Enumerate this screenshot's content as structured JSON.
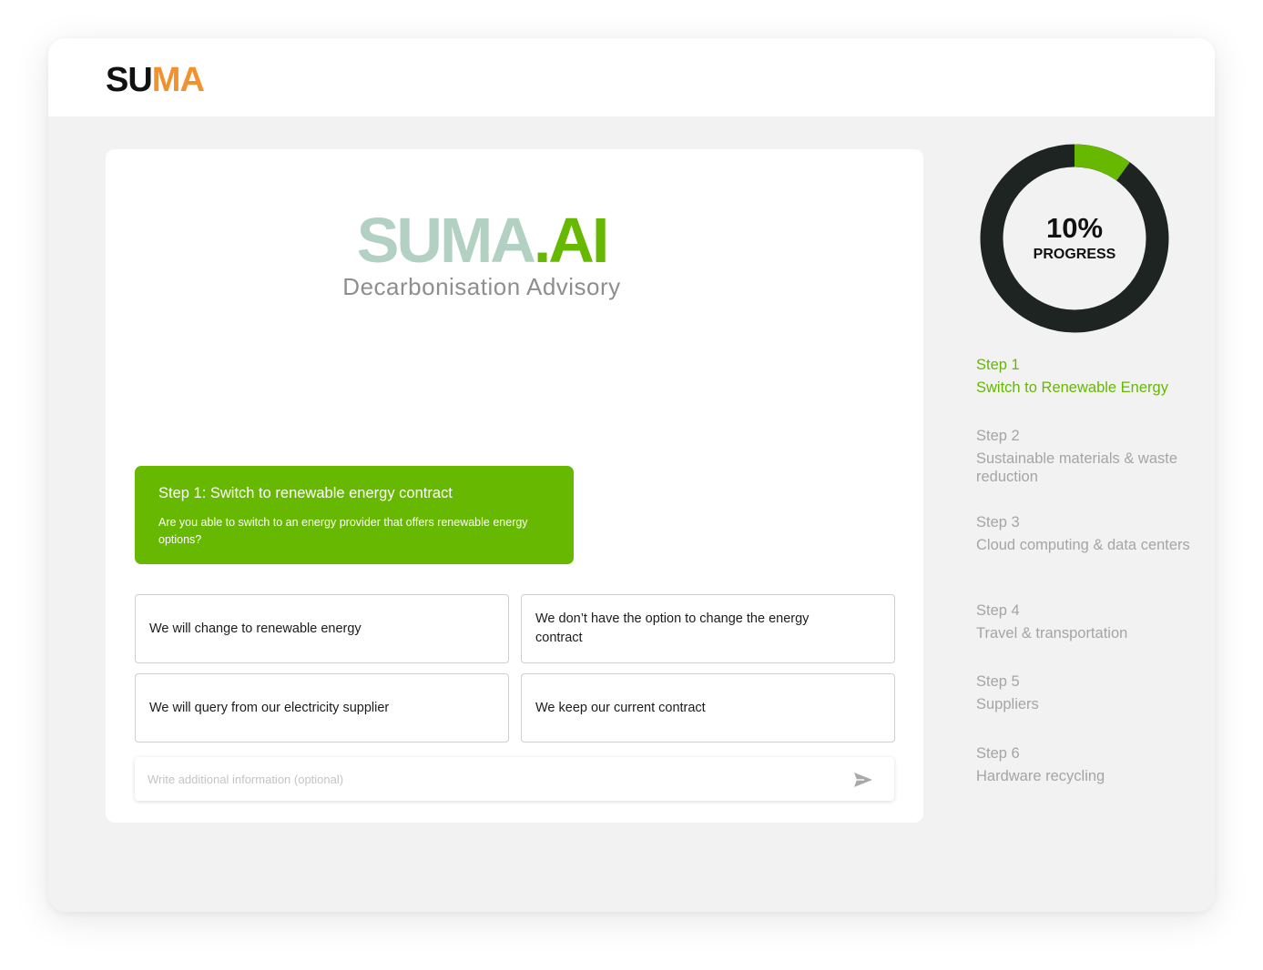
{
  "app": {
    "brand_part1": "SU",
    "brand_part2": "MA",
    "accent_color": "#66b800",
    "brand_orange": "#f0922e"
  },
  "hero": {
    "logo_part1": "SUMA",
    "logo_part2": ".AI",
    "subtitle": "Decarbonisation Advisory"
  },
  "question": {
    "title": "Step 1: Switch to renewable energy contract",
    "text": "Are you able to switch to an energy provider that offers renewable energy options?"
  },
  "options": [
    {
      "label": "We will change to renewable energy"
    },
    {
      "label": "We don’t have the option to change the energy contract"
    },
    {
      "label": "We will query from our electricity supplier"
    },
    {
      "label": "We keep our current contract"
    }
  ],
  "input": {
    "placeholder": "Write additional information (optional)",
    "send_icon": "send-icon"
  },
  "progress": {
    "value_text": "10%",
    "label": "PROGRESS",
    "fraction": 0.1,
    "fill_color": "#66b800",
    "track_color": "#1d2421"
  },
  "steps": [
    {
      "number": "Step 1",
      "title": "Switch to Renewable Energy",
      "active": true
    },
    {
      "number": "Step 2",
      "title": "Sustainable materials & waste reduction",
      "active": false
    },
    {
      "number": "Step 3",
      "title": "Cloud computing & data centers",
      "active": false
    },
    {
      "number": "Step 4",
      "title": "Travel & transportation",
      "active": false
    },
    {
      "number": "Step 5",
      "title": "Suppliers",
      "active": false
    },
    {
      "number": "Step 6",
      "title": "Hardware recycling",
      "active": false
    }
  ]
}
